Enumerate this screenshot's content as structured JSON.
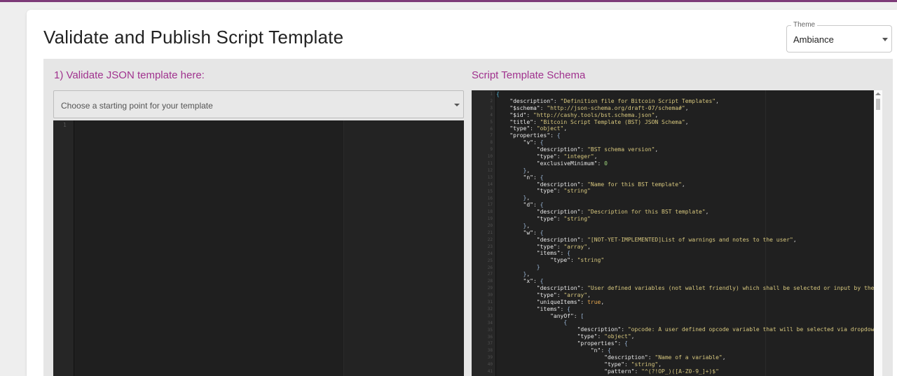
{
  "page": {
    "title": "Validate and Publish Script Template",
    "accent_color": "#a0328e"
  },
  "theme": {
    "label": "Theme",
    "value": "Ambiance"
  },
  "left": {
    "title": "1) Validate JSON template here:",
    "starter_placeholder": "Choose a starting point for your template",
    "editor_line_number": "1"
  },
  "right": {
    "title": "Script Template Schema"
  },
  "schema_lines": [
    [
      {
        "t": "{",
        "c": "br0"
      }
    ],
    [
      {
        "t": "    "
      },
      {
        "t": "\"description\"",
        "c": "k"
      },
      {
        "t": ": "
      },
      {
        "t": "\"Definition file for Bitcoin Script Templates\"",
        "c": "s"
      },
      {
        "t": ","
      }
    ],
    [
      {
        "t": "    "
      },
      {
        "t": "\"$schema\"",
        "c": "k"
      },
      {
        "t": ": "
      },
      {
        "t": "\"http://json-schema.org/draft-07/schema#\"",
        "c": "s"
      },
      {
        "t": ","
      }
    ],
    [
      {
        "t": "    "
      },
      {
        "t": "\"$id\"",
        "c": "k"
      },
      {
        "t": ": "
      },
      {
        "t": "\"http://cashy.tools/bst.schema.json\"",
        "c": "s"
      },
      {
        "t": ","
      }
    ],
    [
      {
        "t": "    "
      },
      {
        "t": "\"title\"",
        "c": "k"
      },
      {
        "t": ": "
      },
      {
        "t": "\"Bitcoin Script Template (BST) JSON Schema\"",
        "c": "s"
      },
      {
        "t": ","
      }
    ],
    [
      {
        "t": "    "
      },
      {
        "t": "\"type\"",
        "c": "k"
      },
      {
        "t": ": "
      },
      {
        "t": "\"object\"",
        "c": "s"
      },
      {
        "t": ","
      }
    ],
    [
      {
        "t": "    "
      },
      {
        "t": "\"properties\"",
        "c": "k"
      },
      {
        "t": ": "
      },
      {
        "t": "{",
        "c": "p"
      }
    ],
    [
      {
        "t": "        "
      },
      {
        "t": "\"v\"",
        "c": "k"
      },
      {
        "t": ": "
      },
      {
        "t": "{",
        "c": "p"
      }
    ],
    [
      {
        "t": "            "
      },
      {
        "t": "\"description\"",
        "c": "k"
      },
      {
        "t": ": "
      },
      {
        "t": "\"BST schema version\"",
        "c": "s"
      },
      {
        "t": ","
      }
    ],
    [
      {
        "t": "            "
      },
      {
        "t": "\"type\"",
        "c": "k"
      },
      {
        "t": ": "
      },
      {
        "t": "\"integer\"",
        "c": "s"
      },
      {
        "t": ","
      }
    ],
    [
      {
        "t": "            "
      },
      {
        "t": "\"exclusiveMinimum\"",
        "c": "k"
      },
      {
        "t": ": "
      },
      {
        "t": "0",
        "c": "n"
      }
    ],
    [
      {
        "t": "        "
      },
      {
        "t": "}",
        "c": "p"
      },
      {
        "t": ","
      }
    ],
    [
      {
        "t": "        "
      },
      {
        "t": "\"n\"",
        "c": "k"
      },
      {
        "t": ": "
      },
      {
        "t": "{",
        "c": "p"
      }
    ],
    [
      {
        "t": "            "
      },
      {
        "t": "\"description\"",
        "c": "k"
      },
      {
        "t": ": "
      },
      {
        "t": "\"Name for this BST template\"",
        "c": "s"
      },
      {
        "t": ","
      }
    ],
    [
      {
        "t": "            "
      },
      {
        "t": "\"type\"",
        "c": "k"
      },
      {
        "t": ": "
      },
      {
        "t": "\"string\"",
        "c": "s"
      }
    ],
    [
      {
        "t": "        "
      },
      {
        "t": "}",
        "c": "p"
      },
      {
        "t": ","
      }
    ],
    [
      {
        "t": "        "
      },
      {
        "t": "\"d\"",
        "c": "k"
      },
      {
        "t": ": "
      },
      {
        "t": "{",
        "c": "p"
      }
    ],
    [
      {
        "t": "            "
      },
      {
        "t": "\"description\"",
        "c": "k"
      },
      {
        "t": ": "
      },
      {
        "t": "\"Description for this BST template\"",
        "c": "s"
      },
      {
        "t": ","
      }
    ],
    [
      {
        "t": "            "
      },
      {
        "t": "\"type\"",
        "c": "k"
      },
      {
        "t": ": "
      },
      {
        "t": "\"string\"",
        "c": "s"
      }
    ],
    [
      {
        "t": "        "
      },
      {
        "t": "}",
        "c": "p"
      },
      {
        "t": ","
      }
    ],
    [
      {
        "t": "        "
      },
      {
        "t": "\"w\"",
        "c": "k"
      },
      {
        "t": ": "
      },
      {
        "t": "{",
        "c": "p"
      }
    ],
    [
      {
        "t": "            "
      },
      {
        "t": "\"description\"",
        "c": "k"
      },
      {
        "t": ": "
      },
      {
        "t": "\"[NOT-YET-IMPLEMENTED]List of warnings and notes to the user\"",
        "c": "s"
      },
      {
        "t": ","
      }
    ],
    [
      {
        "t": "            "
      },
      {
        "t": "\"type\"",
        "c": "k"
      },
      {
        "t": ": "
      },
      {
        "t": "\"array\"",
        "c": "s"
      },
      {
        "t": ","
      }
    ],
    [
      {
        "t": "            "
      },
      {
        "t": "\"items\"",
        "c": "k"
      },
      {
        "t": ": "
      },
      {
        "t": "{",
        "c": "p"
      }
    ],
    [
      {
        "t": "                "
      },
      {
        "t": "\"type\"",
        "c": "k"
      },
      {
        "t": ": "
      },
      {
        "t": "\"string\"",
        "c": "s"
      }
    ],
    [
      {
        "t": "            "
      },
      {
        "t": "}",
        "c": "p"
      }
    ],
    [
      {
        "t": "        "
      },
      {
        "t": "}",
        "c": "p"
      },
      {
        "t": ","
      }
    ],
    [
      {
        "t": "        "
      },
      {
        "t": "\"x\"",
        "c": "k"
      },
      {
        "t": ": "
      },
      {
        "t": "{",
        "c": "p"
      }
    ],
    [
      {
        "t": "            "
      },
      {
        "t": "\"description\"",
        "c": "k"
      },
      {
        "t": ": "
      },
      {
        "t": "\"User defined variables (not wallet friendly) which shall be selected or input by the",
        "c": "s"
      }
    ],
    [
      {
        "t": "            "
      },
      {
        "t": "\"type\"",
        "c": "k"
      },
      {
        "t": ": "
      },
      {
        "t": "\"array\"",
        "c": "s"
      },
      {
        "t": ","
      }
    ],
    [
      {
        "t": "            "
      },
      {
        "t": "\"uniqueItems\"",
        "c": "k"
      },
      {
        "t": ": "
      },
      {
        "t": "true",
        "c": "b"
      },
      {
        "t": ","
      }
    ],
    [
      {
        "t": "            "
      },
      {
        "t": "\"items\"",
        "c": "k"
      },
      {
        "t": ": "
      },
      {
        "t": "{",
        "c": "p"
      }
    ],
    [
      {
        "t": "                "
      },
      {
        "t": "\"anyOf\"",
        "c": "k"
      },
      {
        "t": ": "
      },
      {
        "t": "[",
        "c": "p"
      }
    ],
    [
      {
        "t": "                    "
      },
      {
        "t": "{",
        "c": "p"
      }
    ],
    [
      {
        "t": "                        "
      },
      {
        "t": "\"description\"",
        "c": "k"
      },
      {
        "t": ": "
      },
      {
        "t": "\"opcode: A user defined opcode variable that will be selected via dropdow",
        "c": "s"
      }
    ],
    [
      {
        "t": "                        "
      },
      {
        "t": "\"type\"",
        "c": "k"
      },
      {
        "t": ": "
      },
      {
        "t": "\"object\"",
        "c": "s"
      },
      {
        "t": ","
      }
    ],
    [
      {
        "t": "                        "
      },
      {
        "t": "\"properties\"",
        "c": "k"
      },
      {
        "t": ": "
      },
      {
        "t": "{",
        "c": "p"
      }
    ],
    [
      {
        "t": "                            "
      },
      {
        "t": "\"n\"",
        "c": "k"
      },
      {
        "t": ": "
      },
      {
        "t": "{",
        "c": "p"
      }
    ],
    [
      {
        "t": "                                "
      },
      {
        "t": "\"description\"",
        "c": "k"
      },
      {
        "t": ": "
      },
      {
        "t": "\"Name of a variable\"",
        "c": "s"
      },
      {
        "t": ","
      }
    ],
    [
      {
        "t": "                                "
      },
      {
        "t": "\"type\"",
        "c": "k"
      },
      {
        "t": ": "
      },
      {
        "t": "\"string\"",
        "c": "s"
      },
      {
        "t": ","
      }
    ],
    [
      {
        "t": "                                "
      },
      {
        "t": "\"pattern\"",
        "c": "k"
      },
      {
        "t": ": "
      },
      {
        "t": "\"^(?!OP_)([A-Z0-9_]+)$\"",
        "c": "s"
      }
    ]
  ]
}
